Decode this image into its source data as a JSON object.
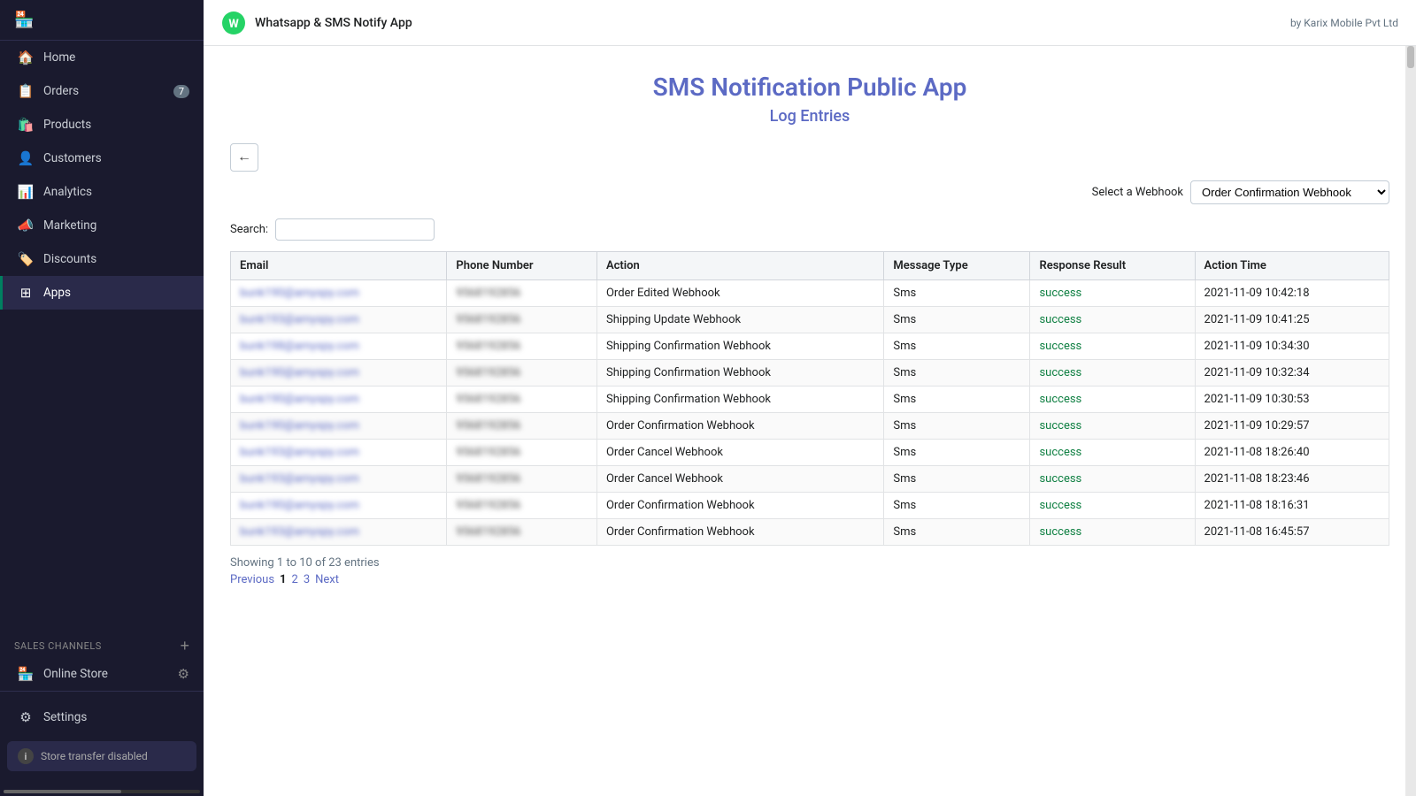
{
  "sidebar": {
    "nav_items": [
      {
        "id": "home",
        "label": "Home",
        "icon": "🏠",
        "active": false
      },
      {
        "id": "orders",
        "label": "Orders",
        "icon": "📋",
        "badge": "7",
        "active": false
      },
      {
        "id": "products",
        "label": "Products",
        "icon": "🛍️",
        "active": false
      },
      {
        "id": "customers",
        "label": "Customers",
        "icon": "👤",
        "active": false
      },
      {
        "id": "analytics",
        "label": "Analytics",
        "icon": "📊",
        "active": false
      },
      {
        "id": "marketing",
        "label": "Marketing",
        "icon": "📣",
        "active": false
      },
      {
        "id": "discounts",
        "label": "Discounts",
        "icon": "🏷️",
        "active": false
      },
      {
        "id": "apps",
        "label": "Apps",
        "icon": "⊞",
        "active": true
      }
    ],
    "sales_channels_label": "SALES CHANNELS",
    "channels": [
      {
        "id": "online-store",
        "label": "Online Store",
        "icon": "🏪"
      }
    ],
    "settings_label": "Settings",
    "store_transfer_label": "Store transfer disabled"
  },
  "app_header": {
    "app_name": "Whatsapp & SMS Notify App",
    "by_text": "by Karix Mobile Pvt Ltd"
  },
  "page": {
    "main_title": "SMS Notification Public App",
    "subtitle": "Log Entries",
    "back_button_label": "←",
    "webhook_label": "Select a Webhook",
    "webhook_selected": "Order Confirmation Webhook",
    "webhook_options": [
      "Order Confirmation Webhook",
      "Order Edited Webhook",
      "Shipping Update Webhook",
      "Shipping Confirmation Webhook",
      "Order Cancel Webhook"
    ],
    "search_label": "Search:",
    "search_placeholder": ""
  },
  "table": {
    "columns": [
      "Email",
      "Phone Number",
      "Action",
      "Message Type",
      "Response Result",
      "Action Time"
    ],
    "rows": [
      {
        "email": "bunk190@amyspy.com",
        "phone": "9568192856",
        "action": "Order Edited Webhook",
        "message_type": "Sms",
        "response": "success",
        "action_time": "2021-11-09 10:42:18"
      },
      {
        "email": "bunk193@amyspy.com",
        "phone": "9568192856",
        "action": "Shipping Update Webhook",
        "message_type": "Sms",
        "response": "success",
        "action_time": "2021-11-09 10:41:25"
      },
      {
        "email": "bunk198@amyspy.com",
        "phone": "9568192856",
        "action": "Shipping Confirmation Webhook",
        "message_type": "Sms",
        "response": "success",
        "action_time": "2021-11-09 10:34:30"
      },
      {
        "email": "bunk190@amyspy.com",
        "phone": "9568192856",
        "action": "Shipping Confirmation Webhook",
        "message_type": "Sms",
        "response": "success",
        "action_time": "2021-11-09 10:32:34"
      },
      {
        "email": "bunk190@amyspy.com",
        "phone": "9568192856",
        "action": "Shipping Confirmation Webhook",
        "message_type": "Sms",
        "response": "success",
        "action_time": "2021-11-09 10:30:53"
      },
      {
        "email": "bunk190@amyspy.com",
        "phone": "9568192856",
        "action": "Order Confirmation Webhook",
        "message_type": "Sms",
        "response": "success",
        "action_time": "2021-11-09 10:29:57"
      },
      {
        "email": "bunk193@amyspy.com",
        "phone": "9568192856",
        "action": "Order Cancel Webhook",
        "message_type": "Sms",
        "response": "success",
        "action_time": "2021-11-08 18:26:40"
      },
      {
        "email": "bunk193@amyspy.com",
        "phone": "9568192856",
        "action": "Order Cancel Webhook",
        "message_type": "Sms",
        "response": "success",
        "action_time": "2021-11-08 18:23:46"
      },
      {
        "email": "bunk190@amyspy.com",
        "phone": "9568192856",
        "action": "Order Confirmation Webhook",
        "message_type": "Sms",
        "response": "success",
        "action_time": "2021-11-08 18:16:31"
      },
      {
        "email": "bunk193@amyspy.com",
        "phone": "9568192856",
        "action": "Order Confirmation Webhook",
        "message_type": "Sms",
        "response": "success",
        "action_time": "2021-11-08 16:45:57"
      }
    ],
    "footer_text": "Showing 1 to 10 of 23 entries",
    "pagination": [
      {
        "label": "Previous",
        "type": "prev"
      },
      {
        "label": "1",
        "type": "current"
      },
      {
        "label": "2",
        "type": "page"
      },
      {
        "label": "3",
        "type": "page"
      },
      {
        "label": "Next",
        "type": "next"
      }
    ]
  }
}
